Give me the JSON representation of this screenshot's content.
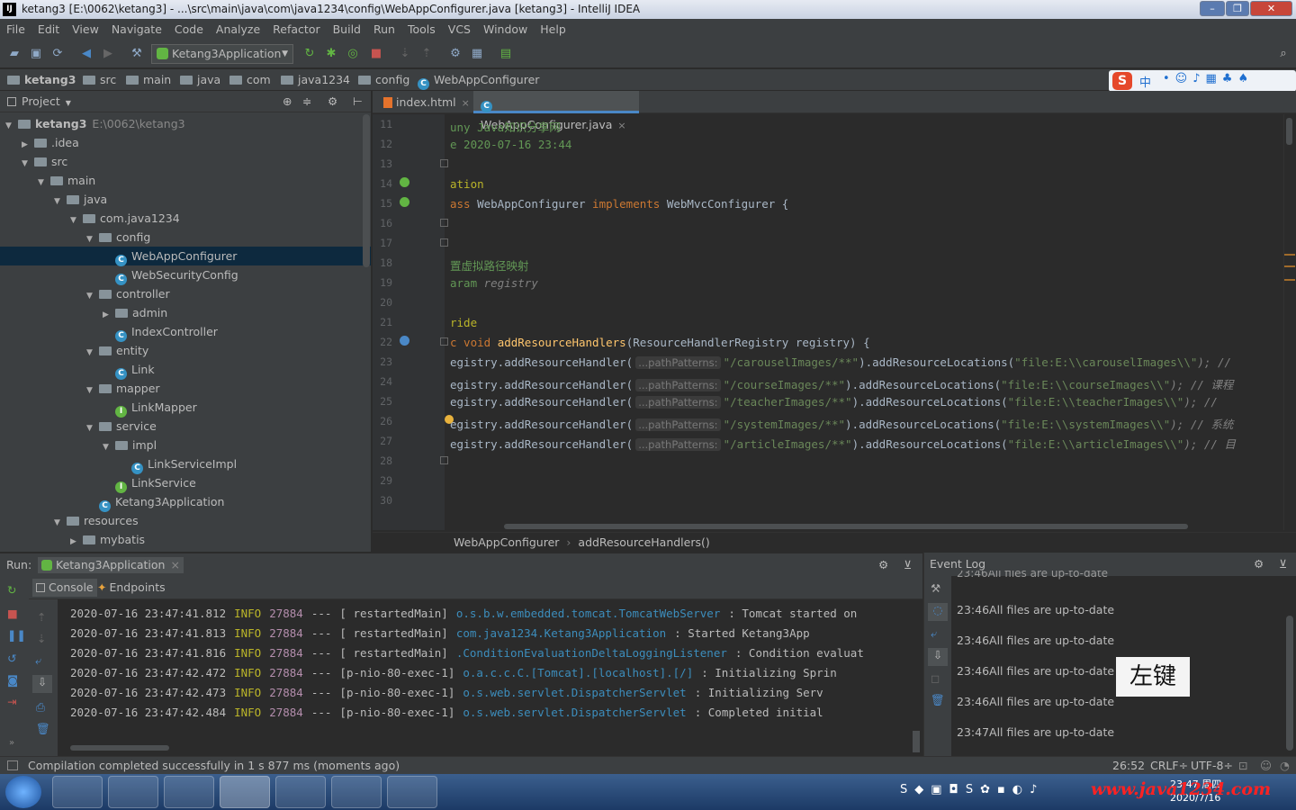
{
  "window": {
    "title": "ketang3 [E:\\0062\\ketang3] - ...\\src\\main\\java\\com\\java1234\\config\\WebAppConfigurer.java [ketang3] - IntelliJ IDEA",
    "min": "–",
    "max": "❐",
    "close": "✕"
  },
  "menu": [
    "File",
    "Edit",
    "View",
    "Navigate",
    "Code",
    "Analyze",
    "Refactor",
    "Build",
    "Run",
    "Tools",
    "VCS",
    "Window",
    "Help"
  ],
  "toolbar": {
    "run_config": "Ketang3Application",
    "search_icon": "⌕"
  },
  "navbar": {
    "crumbs": [
      "ketang3",
      "src",
      "main",
      "java",
      "com",
      "java1234",
      "config",
      "WebAppConfigurer"
    ]
  },
  "ime": {
    "label": "中"
  },
  "project": {
    "header": "Project",
    "tree": [
      {
        "label": "ketang3",
        "extra": "E:\\0062\\ketang3",
        "level": 0,
        "arrow": "▼",
        "icon": "folder",
        "bold": true
      },
      {
        "label": ".idea",
        "level": 1,
        "arrow": "▶",
        "icon": "folder"
      },
      {
        "label": "src",
        "level": 1,
        "arrow": "▼",
        "icon": "folder"
      },
      {
        "label": "main",
        "level": 2,
        "arrow": "▼",
        "icon": "folder"
      },
      {
        "label": "java",
        "level": 3,
        "arrow": "▼",
        "icon": "folder"
      },
      {
        "label": "com.java1234",
        "level": 4,
        "arrow": "▼",
        "icon": "folder"
      },
      {
        "label": "config",
        "level": 5,
        "arrow": "▼",
        "icon": "folder"
      },
      {
        "label": "WebAppConfigurer",
        "level": 6,
        "arrow": "",
        "icon": "class",
        "selected": true
      },
      {
        "label": "WebSecurityConfig",
        "level": 6,
        "arrow": "",
        "icon": "class"
      },
      {
        "label": "controller",
        "level": 5,
        "arrow": "▼",
        "icon": "folder"
      },
      {
        "label": "admin",
        "level": 6,
        "arrow": "▶",
        "icon": "folder"
      },
      {
        "label": "IndexController",
        "level": 6,
        "arrow": "",
        "icon": "class"
      },
      {
        "label": "entity",
        "level": 5,
        "arrow": "▼",
        "icon": "folder"
      },
      {
        "label": "Link",
        "level": 6,
        "arrow": "",
        "icon": "class"
      },
      {
        "label": "mapper",
        "level": 5,
        "arrow": "▼",
        "icon": "folder"
      },
      {
        "label": "LinkMapper",
        "level": 6,
        "arrow": "",
        "icon": "iface"
      },
      {
        "label": "service",
        "level": 5,
        "arrow": "▼",
        "icon": "folder"
      },
      {
        "label": "impl",
        "level": 6,
        "arrow": "▼",
        "icon": "folder"
      },
      {
        "label": "LinkServiceImpl",
        "level": 7,
        "arrow": "",
        "icon": "class"
      },
      {
        "label": "LinkService",
        "level": 6,
        "arrow": "",
        "icon": "iface"
      },
      {
        "label": "Ketang3Application",
        "level": 5,
        "arrow": "",
        "icon": "class"
      },
      {
        "label": "resources",
        "level": 3,
        "arrow": "▼",
        "icon": "folder"
      },
      {
        "label": "mybatis",
        "level": 4,
        "arrow": "▶",
        "icon": "folder"
      }
    ]
  },
  "editor": {
    "tabs": [
      "index.html",
      "WebAppConfigurer.java"
    ],
    "line_numbers": [
      "11",
      "12",
      "13",
      "14",
      "15",
      "16",
      "17",
      "18",
      "19",
      "20",
      "21",
      "22",
      "23",
      "24",
      "25",
      "26",
      "27",
      "28",
      "29",
      "30"
    ],
    "lines": [
      [
        {
          "t": "uny Java知识分享网",
          "c": "jd"
        }
      ],
      [
        {
          "t": "e 2020-07-16 23:44",
          "c": "jd"
        }
      ],
      [],
      [
        {
          "t": "ation",
          "c": "ann"
        }
      ],
      [
        {
          "t": "ass ",
          "c": "kw"
        },
        {
          "t": "WebAppConfigurer ",
          "c": ""
        },
        {
          "t": "implements ",
          "c": "kw"
        },
        {
          "t": "WebMvcConfigurer {",
          "c": ""
        }
      ],
      [],
      [],
      [
        {
          "t": "置虚拟路径映射",
          "c": "jd"
        }
      ],
      [
        {
          "t": "aram",
          "c": "jd"
        },
        {
          "t": " registry",
          "c": "cm"
        }
      ],
      [],
      [
        {
          "t": "ride",
          "c": "ann"
        }
      ],
      [
        {
          "t": "c void ",
          "c": "kw"
        },
        {
          "t": "addResourceHandlers",
          "c": "fn"
        },
        {
          "t": "(ResourceHandlerRegistry registry) {",
          "c": ""
        }
      ],
      [
        {
          "t": "egistry.addResourceHandler(",
          "c": ""
        },
        {
          "t": "...pathPatterns:",
          "c": "hint"
        },
        {
          "t": "\"/carouselImages/**\"",
          "c": "str"
        },
        {
          "t": ").addResourceLocations(",
          "c": ""
        },
        {
          "t": "\"file:E:\\\\carouselImages\\\\\"",
          "c": "str"
        },
        {
          "t": "); //",
          "c": "cm"
        }
      ],
      [
        {
          "t": "egistry.addResourceHandler(",
          "c": ""
        },
        {
          "t": "...pathPatterns:",
          "c": "hint"
        },
        {
          "t": "\"/courseImages/**\"",
          "c": "str"
        },
        {
          "t": ").addResourceLocations(",
          "c": ""
        },
        {
          "t": "\"file:E:\\\\courseImages\\\\\"",
          "c": "str"
        },
        {
          "t": ");  // 课程",
          "c": "cm"
        }
      ],
      [
        {
          "t": "egistry.addResourceHandler(",
          "c": ""
        },
        {
          "t": "...pathPatterns:",
          "c": "hint"
        },
        {
          "t": "\"/teacherImages/**\"",
          "c": "str"
        },
        {
          "t": ").addResourceLocations(",
          "c": ""
        },
        {
          "t": "\"file:E:\\\\teacherImages\\\\\"",
          "c": "str"
        },
        {
          "t": ");  //",
          "c": "cm"
        }
      ],
      [
        {
          "t": "egistry.addResourceHandler(",
          "c": ""
        },
        {
          "t": "...pathPatterns:",
          "c": "hint"
        },
        {
          "t": "\"/systemImages/**\"",
          "c": "str"
        },
        {
          "t": ").addResourceLocations(",
          "c": ""
        },
        {
          "t": "\"file:E:\\\\systemImages\\\\\"",
          "c": "str"
        },
        {
          "t": ");  // 系统",
          "c": "cm"
        }
      ],
      [
        {
          "t": "egistry.addResourceHandler(",
          "c": ""
        },
        {
          "t": "...pathPatterns:",
          "c": "hint"
        },
        {
          "t": "\"/articleImages/**\"",
          "c": "str"
        },
        {
          "t": ").addResourceLocations(",
          "c": ""
        },
        {
          "t": "\"file:E:\\\\articleImages\\\\\"",
          "c": "str"
        },
        {
          "t": ");  // 目",
          "c": "cm"
        }
      ],
      [],
      [],
      []
    ],
    "breadcrumb": [
      "WebAppConfigurer",
      "addResourceHandlers()"
    ]
  },
  "run": {
    "label": "Run:",
    "config": "Ketang3Application",
    "tabs": [
      "Console",
      "Endpoints"
    ],
    "log": [
      {
        "ts": "2020-07-16 23:47:41.812",
        "lvl": "INFO",
        "pid": "27884",
        "sep": "---",
        "thread": "[  restartedMain]",
        "logger": "o.s.b.w.embedded.tomcat.TomcatWebServer",
        "msg": ": Tomcat started on"
      },
      {
        "ts": "2020-07-16 23:47:41.813",
        "lvl": "INFO",
        "pid": "27884",
        "sep": "---",
        "thread": "[  restartedMain]",
        "logger": "com.java1234.Ketang3Application",
        "msg": ": Started Ketang3App"
      },
      {
        "ts": "2020-07-16 23:47:41.816",
        "lvl": "INFO",
        "pid": "27884",
        "sep": "---",
        "thread": "[  restartedMain]",
        "logger": ".ConditionEvaluationDeltaLoggingListener",
        "msg": ": Condition evaluat"
      },
      {
        "ts": "2020-07-16 23:47:42.472",
        "lvl": "INFO",
        "pid": "27884",
        "sep": "---",
        "thread": "[p-nio-80-exec-1]",
        "logger": "o.a.c.c.C.[Tomcat].[localhost].[/]",
        "msg": ": Initializing Sprin"
      },
      {
        "ts": "2020-07-16 23:47:42.473",
        "lvl": "INFO",
        "pid": "27884",
        "sep": "---",
        "thread": "[p-nio-80-exec-1]",
        "logger": "o.s.web.servlet.DispatcherServlet",
        "msg": ": Initializing Serv"
      },
      {
        "ts": "2020-07-16 23:47:42.484",
        "lvl": "INFO",
        "pid": "27884",
        "sep": "---",
        "thread": "[p-nio-80-exec-1]",
        "logger": "o.s.web.servlet.DispatcherServlet",
        "msg": ": Completed initial"
      }
    ]
  },
  "event_log": {
    "title": "Event Log",
    "entries": [
      {
        "time": "23:46",
        "text": "All files are up-to-date"
      },
      {
        "time": "23:46",
        "text": "All files are up-to-date"
      },
      {
        "time": "23:46",
        "text": "All files are up-to-date"
      },
      {
        "time": "23:46",
        "text": "All files are up-to-date"
      },
      {
        "time": "23:47",
        "text": "All files are up-to-date"
      },
      {
        "time": "23:47",
        "text": "Compilation completed successfully in 1 s 877 ms",
        "link": true
      }
    ],
    "truncated_top": "23:46All files are up-to-date"
  },
  "tooltip": {
    "text": "左键"
  },
  "status": {
    "message": "Compilation completed successfully in 1 s 877 ms (moments ago)",
    "position": "26:52",
    "line_sep": "CRLF÷",
    "encoding": "UTF-8÷"
  },
  "taskbar": {
    "time": "23:47 周四",
    "date": "2020/7/16"
  },
  "watermark": "www.java1234.com"
}
